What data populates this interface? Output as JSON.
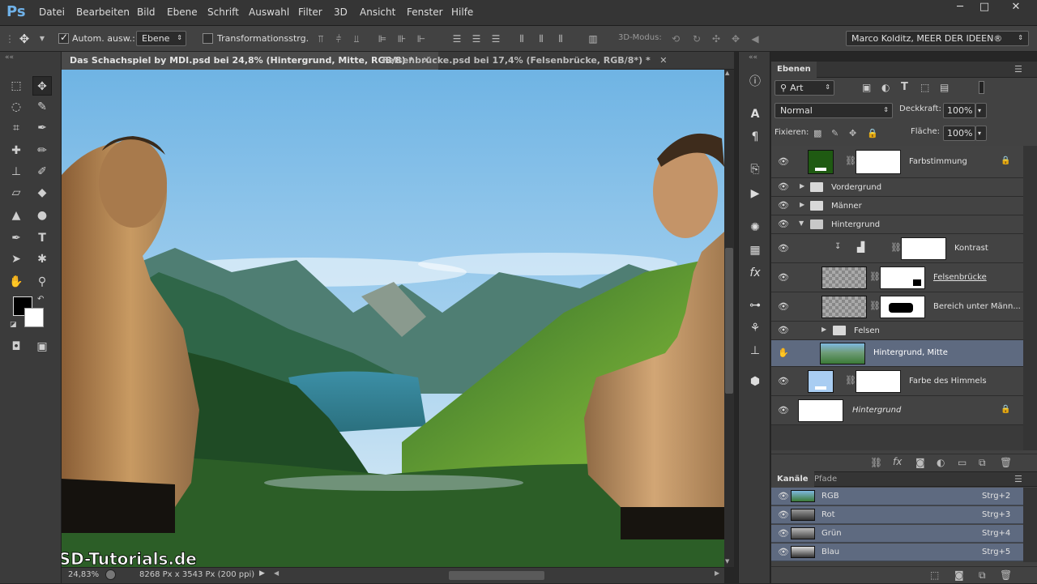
{
  "app": {
    "logo": "Ps"
  },
  "menu": [
    "Datei",
    "Bearbeiten",
    "Bild",
    "Ebene",
    "Schrift",
    "Auswahl",
    "Filter",
    "3D",
    "Ansicht",
    "Fenster",
    "Hilfe"
  ],
  "window_buttons": {
    "minimize": "─",
    "maximize": "□",
    "close": "✕"
  },
  "options": {
    "auto_select_label": "Autom. ausw.:",
    "auto_select_value": "Ebene",
    "transform_label": "Transformationsstrg.",
    "mode3d_label": "3D-Modus:",
    "workspace": "Marco Kolditz, MEER DER IDEEN®"
  },
  "tabs": [
    {
      "label": "Das Schachspiel by MDI.psd bei 24,8% (Hintergrund, Mitte, RGB/8) *",
      "active": true
    },
    {
      "label": "Felsenbrücke.psd bei 17,4% (Felsenbrücke, RGB/8*) *",
      "active": false
    }
  ],
  "canvas": {
    "watermark": "PSD-Tutorials.de"
  },
  "status": {
    "zoom": "24,83%",
    "doc_info": "8268 Px x 3543 Px (200 ppi)"
  },
  "layers_panel": {
    "title": "Ebenen",
    "filter_kind": "Art",
    "blend_mode": "Normal",
    "opacity_label": "Deckkraft:",
    "opacity": "100%",
    "lock_label": "Fixieren:",
    "fill_label": "Fläche:",
    "fill": "100%",
    "layers": [
      {
        "name": "Farbstimmung"
      },
      {
        "name": "Vordergrund"
      },
      {
        "name": "Männer"
      },
      {
        "name": "Hintergrund"
      },
      {
        "name": "Kontrast"
      },
      {
        "name": "Felsenbrücke"
      },
      {
        "name": "Bereich unter Männ..."
      },
      {
        "name": "Felsen"
      },
      {
        "name": "Hintergrund, Mitte"
      },
      {
        "name": "Farbe des Himmels"
      },
      {
        "name": "Hintergrund"
      }
    ]
  },
  "channels_panel": {
    "tabs": [
      "Kanäle",
      "Pfade"
    ],
    "channels": [
      {
        "name": "RGB",
        "shortcut": "Strg+2"
      },
      {
        "name": "Rot",
        "shortcut": "Strg+3"
      },
      {
        "name": "Grün",
        "shortcut": "Strg+4"
      },
      {
        "name": "Blau",
        "shortcut": "Strg+5"
      }
    ]
  },
  "colors": {
    "accent_selection": "#5e6a80",
    "swatch_green": "#1f5a12",
    "swatch_sky": "#a9cdf2"
  }
}
